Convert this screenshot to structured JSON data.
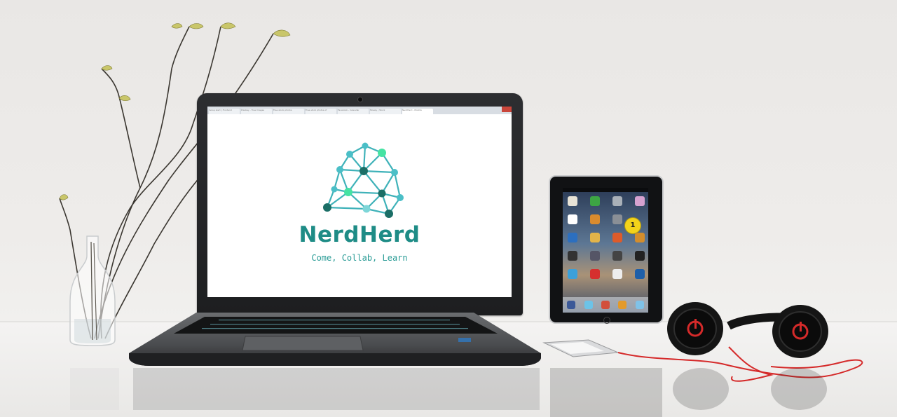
{
  "screen": {
    "browser_tabs": [
      "Setup start | Frontend",
      "Pixabay - Free Images",
      "Free stock photos",
      "Free stock photos of",
      "Facebook - Calendar",
      "Mossly | Stock",
      "NerdHerd - Mozilla"
    ],
    "brand_name": "NerdHerd",
    "tagline": "Come, Collab, Learn"
  },
  "ipad": {
    "badge_value": "1"
  },
  "colors": {
    "brand_teal": "#1e8c86",
    "node_teal": "#4bbfc7",
    "node_green": "#45e3a3",
    "node_dark": "#1b6e66",
    "headphone_red": "#d52a2a"
  },
  "icons": [
    "plant-vase-icon",
    "network-brain-logo-icon",
    "headphones-icon",
    "ipod-icon"
  ]
}
